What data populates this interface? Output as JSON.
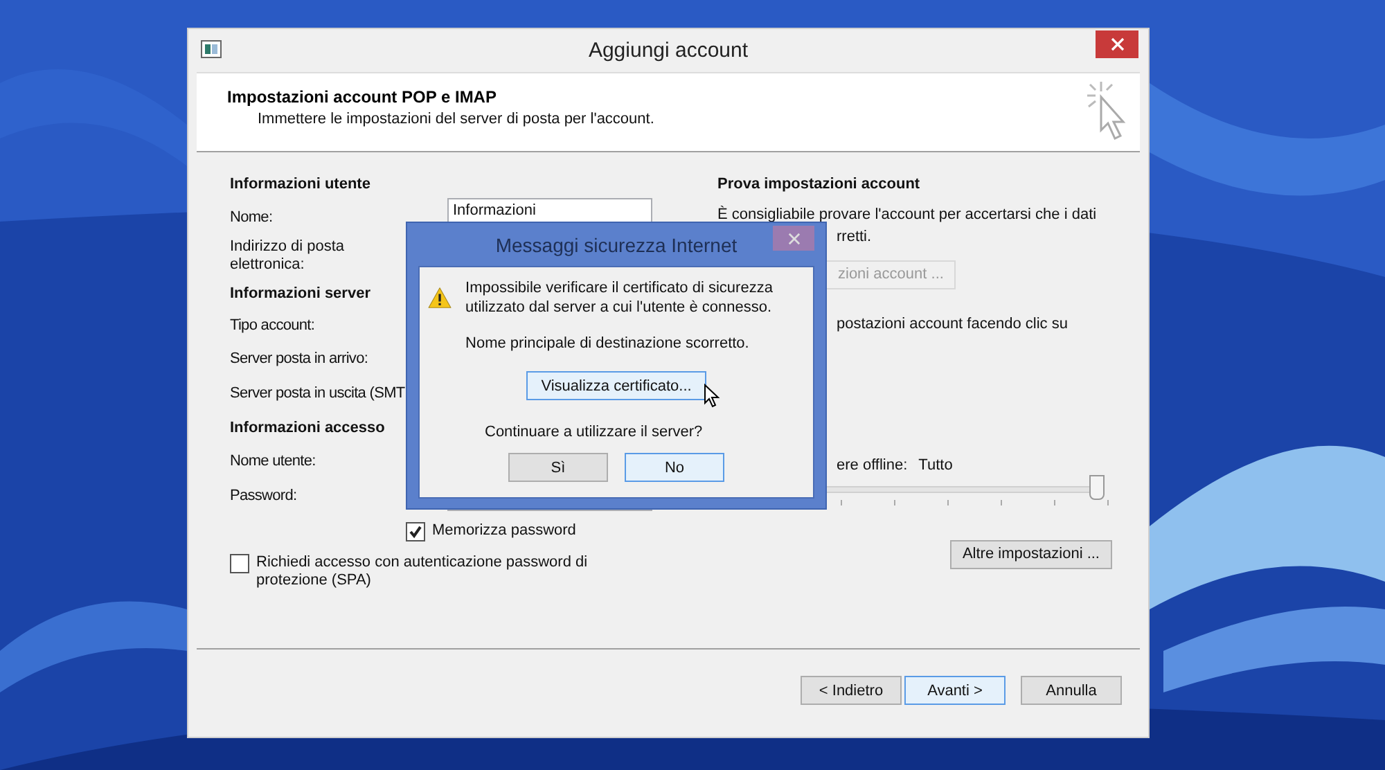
{
  "window": {
    "title": "Aggiungi account"
  },
  "header": {
    "title": "Impostazioni account POP e IMAP",
    "subtitle": "Immettere le impostazioni del server di posta per l'account."
  },
  "left_rows": [
    {
      "kind": "heading",
      "label": "Informazioni utente"
    },
    {
      "kind": "field",
      "label": "Nome:",
      "value": "Informazioni"
    },
    {
      "kind": "label",
      "label": "Indirizzo di posta elettronica:"
    },
    {
      "kind": "heading",
      "label": "Informazioni server"
    },
    {
      "kind": "label",
      "label": "Tipo account:"
    },
    {
      "kind": "label",
      "label": "Server posta in arrivo:"
    },
    {
      "kind": "label",
      "label": "Server posta in uscita (SMT"
    },
    {
      "kind": "heading",
      "label": "Informazioni accesso"
    },
    {
      "kind": "label",
      "label": "Nome utente:"
    },
    {
      "kind": "field",
      "label": "Password:",
      "value": ""
    },
    {
      "kind": "checkbox",
      "label": "Memorizza password",
      "checked": true,
      "indent": true
    },
    {
      "kind": "checkbox",
      "label": "Richiedi accesso con autenticazione password di protezione (SPA)",
      "checked": false,
      "indent": false
    }
  ],
  "test_section": {
    "title": "Prova impostazioni account",
    "intro": "È consigliabile provare l'account per accertarsi che i dati",
    "intro_cont": "rretti.",
    "test_button": {
      "label": "zioni account ...",
      "disabled": true
    },
    "note": "postazioni account facendo clic su",
    "offline_label": "ere offline:",
    "offline_value": "Tutto",
    "slider": {
      "level": 1
    },
    "more_button": "Altre impostazioni ..."
  },
  "footer_buttons": [
    {
      "label": "< Indietro",
      "default": false
    },
    {
      "label": "Avanti >",
      "default": true
    },
    {
      "label": "Annulla",
      "default": false
    }
  ],
  "dialog": {
    "title": "Messaggi sicurezza Internet",
    "message": "Impossibile verificare il certificato di sicurezza utilizzato dal server a cui l'utente è connesso.",
    "detail": "Nome principale di destinazione scorretto.",
    "view_button": {
      "label": "Visualizza certificato...",
      "hovered": true
    },
    "question": "Continuare a utilizzare il server?",
    "buttons": [
      {
        "label": "Sì",
        "default": false
      },
      {
        "label": "No",
        "default": true
      }
    ]
  }
}
